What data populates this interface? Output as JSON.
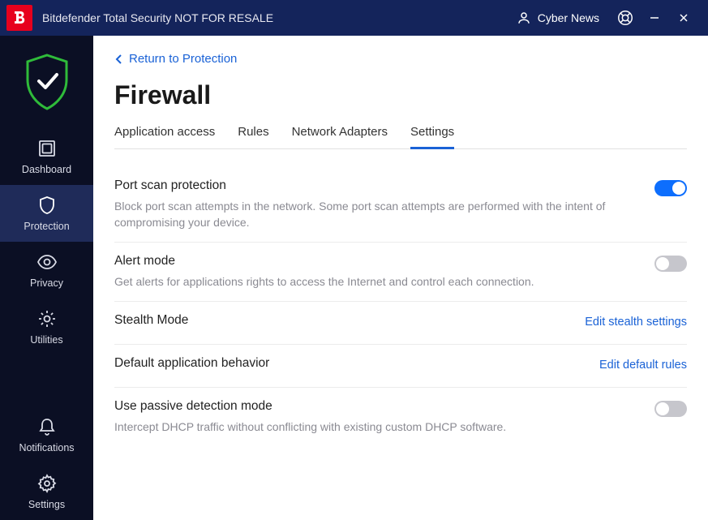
{
  "titlebar": {
    "app_title": "Bitdefender Total Security NOT FOR RESALE",
    "user_name": "Cyber News"
  },
  "sidebar": {
    "items": [
      {
        "label": "Dashboard"
      },
      {
        "label": "Protection"
      },
      {
        "label": "Privacy"
      },
      {
        "label": "Utilities"
      },
      {
        "label": "Notifications"
      },
      {
        "label": "Settings"
      }
    ]
  },
  "main": {
    "back_label": "Return to Protection",
    "page_title": "Firewall",
    "tabs": [
      {
        "label": "Application access"
      },
      {
        "label": "Rules"
      },
      {
        "label": "Network Adapters"
      },
      {
        "label": "Settings"
      }
    ],
    "active_tab_index": 3,
    "settings": [
      {
        "name": "Port scan protection",
        "desc": "Block port scan attempts in the network. Some port scan attempts are performed with the intent of compromising your device.",
        "control": "toggle",
        "value": true
      },
      {
        "name": "Alert mode",
        "desc": "Get alerts for applications rights to access the Internet and control each connection.",
        "control": "toggle",
        "value": false
      },
      {
        "name": "Stealth Mode",
        "control": "link",
        "link_label": "Edit stealth settings"
      },
      {
        "name": "Default application behavior",
        "control": "link",
        "link_label": "Edit default rules"
      },
      {
        "name": "Use passive detection mode",
        "desc": "Intercept DHCP traffic without conflicting with existing custom DHCP software.",
        "control": "toggle",
        "value": false
      }
    ]
  }
}
